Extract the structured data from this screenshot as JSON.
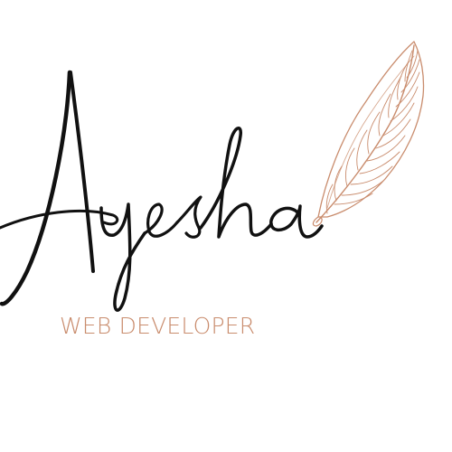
{
  "logo": {
    "name": "Ayesha",
    "tagline": "WEB DEVELOPER"
  },
  "colors": {
    "background": "#ffffff",
    "script": "#111111",
    "accent": "#c98c6d"
  },
  "icons": {
    "feather": "feather-quill-icon"
  }
}
